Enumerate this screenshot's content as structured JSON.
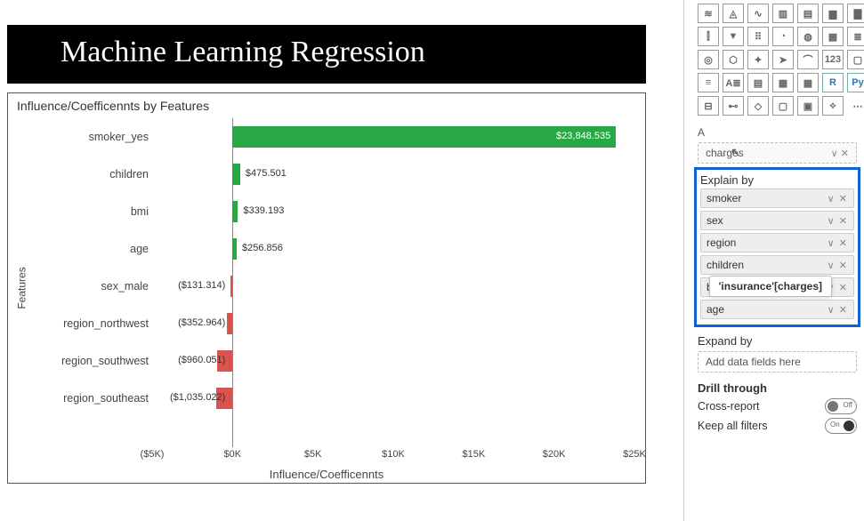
{
  "title_banner": "Machine Learning Regression",
  "chart_data": {
    "type": "bar",
    "orientation": "horizontal",
    "title": "Influence/Coefficennts by Features",
    "xlabel": "Influence/Coefficennts",
    "ylabel": "Features",
    "xlim": [
      -5000,
      25000
    ],
    "xticks": [
      "($5K)",
      "$0K",
      "$5K",
      "$10K",
      "$15K",
      "$20K",
      "$25K"
    ],
    "categories": [
      "smoker_yes",
      "children",
      "bmi",
      "age",
      "sex_male",
      "region_northwest",
      "region_southwest",
      "region_southeast"
    ],
    "values": [
      23848.535,
      475.501,
      339.193,
      256.856,
      -131.314,
      -352.964,
      -960.051,
      -1035.022
    ],
    "value_labels": [
      "$23,848.535",
      "$475.501",
      "$339.193",
      "$256.856",
      "($131.314)",
      "($352.964)",
      "($960.051)",
      "($1,035.022)"
    ],
    "colors": {
      "positive": "#27a844",
      "negative": "#d9534f"
    }
  },
  "side_panel": {
    "tooltip": "'insurance'[charges]",
    "analyze_truncated": "A",
    "analyze_field": "charges",
    "explain_by_label": "Explain by",
    "explain_by_fields": [
      "smoker",
      "sex",
      "region",
      "children",
      "bmi",
      "age"
    ],
    "expand_by_label": "Expand by",
    "expand_by_placeholder": "Add data fields here",
    "drill_through_label": "Drill through",
    "cross_report_label": "Cross-report",
    "cross_report_state": "Off",
    "keep_filters_label": "Keep all filters",
    "keep_filters_state": "On",
    "viz_icons": [
      "line-chart-icon",
      "area-chart-icon",
      "ribbon-chart-icon",
      "clustered-bar-icon",
      "stacked-bar-icon",
      "column-chart-icon",
      "stacked-column-icon",
      "clustered-column-icon",
      "funnel-icon",
      "scatter-icon",
      "pie-icon",
      "donut-icon",
      "treemap-icon",
      "waterfall-icon",
      "globe-map-icon",
      "filled-map-icon",
      "shape-map-icon",
      "arcgis-icon",
      "gauge-icon",
      "kpi-icon",
      "card-icon",
      "multi-row-card-icon",
      "slicer-icon",
      "matrix-icon",
      "table-icon",
      "table2-icon",
      "r-visual-icon",
      "py-visual-icon",
      "decomposition-icon",
      "key-influencers-icon",
      "qa-icon",
      "narrative-icon",
      "paginated-icon",
      "app-icon",
      "more-icon"
    ],
    "viz_glyphs": [
      "≋",
      "◬",
      "∿",
      "▥",
      "▤",
      "▆",
      "▇",
      "⫿",
      "▼",
      "⠿",
      "◔",
      "◍",
      "▦",
      "≣",
      "◎",
      "⬡",
      "✦",
      "➤",
      "⌒",
      "123",
      "▢",
      "≡",
      "A≣",
      "▤",
      "▦",
      "▦",
      "R",
      "Py",
      "⊟",
      "⊷",
      "◇",
      "▢",
      "▣",
      "⟡",
      "⋯"
    ]
  }
}
